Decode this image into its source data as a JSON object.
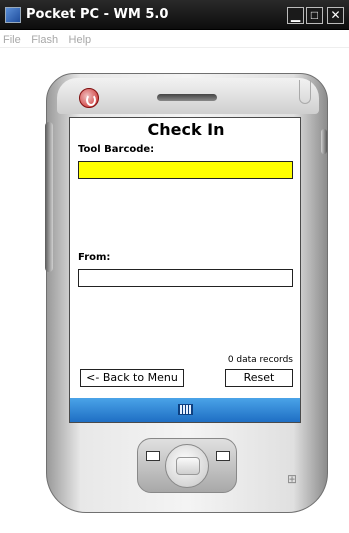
{
  "window": {
    "title": "Pocket PC - WM 5.0",
    "buttons": {
      "minimize": "▁",
      "maximize": "□",
      "close": "✕"
    }
  },
  "menu": {
    "items": [
      "File",
      "Flash",
      "Help"
    ]
  },
  "app": {
    "title": "Check In",
    "tool_barcode_label": "Tool Barcode:",
    "tool_barcode_value": "",
    "from_label": "From:",
    "from_value": "",
    "records": "0 data records",
    "back_button": "<- Back to Menu",
    "reset_button": "Reset"
  },
  "colors": {
    "barcode_field_bg": "#ffff00",
    "taskbar": "#2a85d6",
    "power_button": "#c82020"
  },
  "icons": {
    "power": "power-icon",
    "keyboard": "keyboard-icon",
    "windows_logo": "windows-logo-icon"
  }
}
